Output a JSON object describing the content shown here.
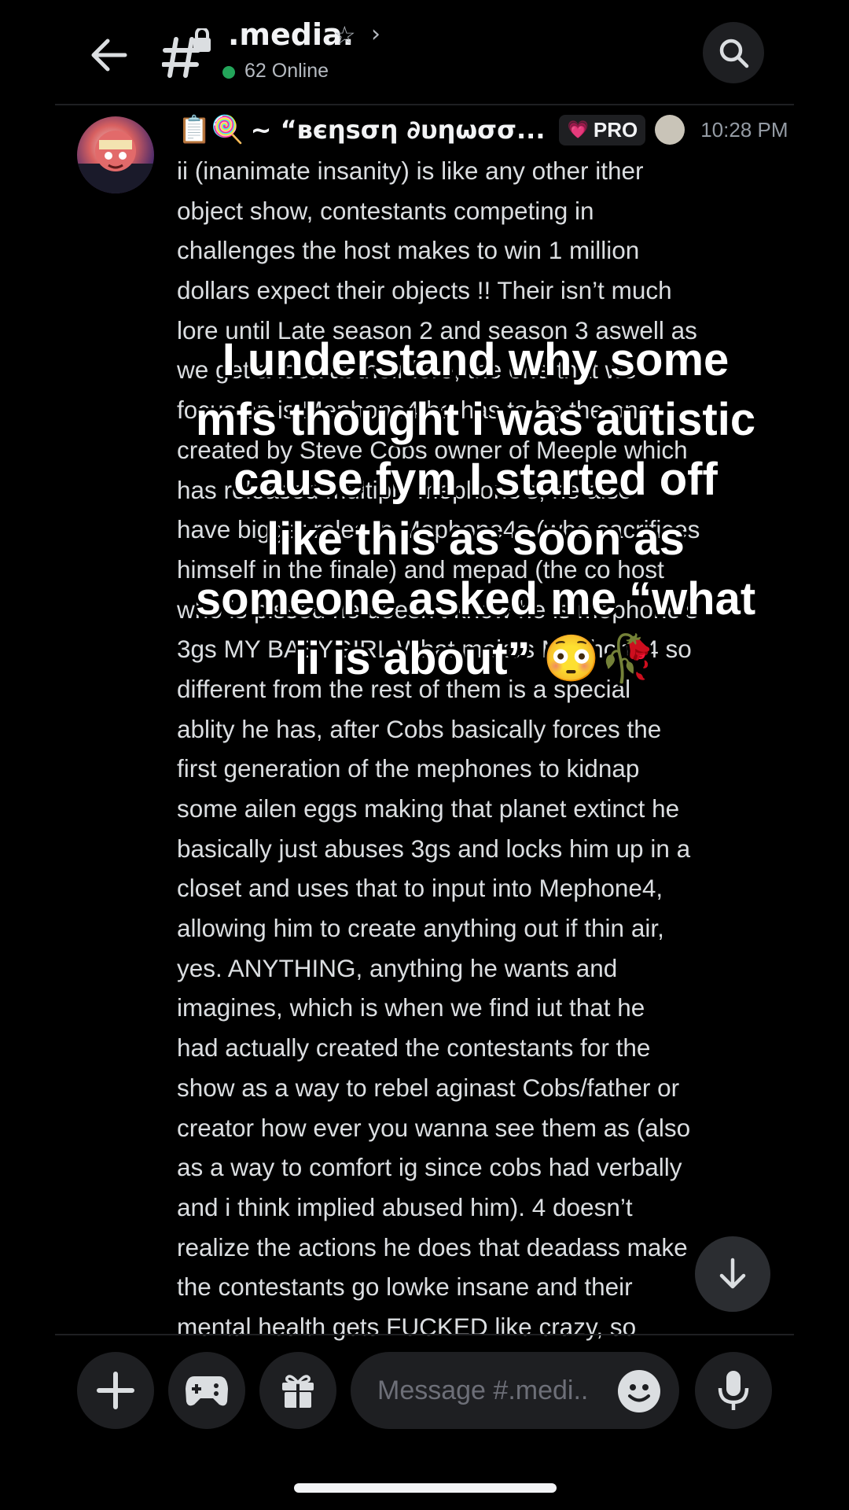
{
  "header": {
    "channel_name": ".media.",
    "online_count": "62 Online",
    "icons": [
      "back-arrow-icon",
      "text-channel-lock-icon",
      "star-icon",
      "chevron-right-icon",
      "search-icon"
    ]
  },
  "message": {
    "author_prefix_emoji": "📋🍭",
    "author": "~ “вєηѕση ∂υηωσσ...",
    "badge_text": "PRO",
    "badge_heart": "💗",
    "timestamp": "10:28 PM",
    "lines": [
      "ii (inanimate insanity) is like any other ither",
      "object show, contestants competing in",
      "challenges the host makes to win 1 million",
      "dollars expect their objects !! Their isn’t much",
      "lore until Late season 2 and season 3 aswell as",
      "we get a look at their lore, the one that we",
      "focus on is Mephone4 he has to be the one",
      "created by Steve Cobs owner of Meeple which",
      "has released multiple mephone’s, he also",
      "have bigger roles in Mephone4s (who sacrifices",
      "himself in the finale) and mepad (the co host",
      "who is pissed he doesn’t know he is mephone’s",
      "3gs MY BABYGIRL What makes Mephone4 so",
      "different from the rest of them is a special",
      "ablity he has, after Cobs basically forces the",
      "first generation of the mephones to kidnap",
      "some ailen eggs making that planet extinct he",
      "basically just abuses 3gs and locks him up in a",
      "closet and uses that to input into Mephone4,",
      "allowing him to create anything out if thin air,",
      "yes. ANYTHING, anything he wants and",
      "imagines, which is when we find iut that he",
      "had actually created the contestants for the",
      "show as a way to rebel aginast Cobs/father or",
      "creator how ever you wanna see them as (also",
      "as a way to comfort ig since cobs had verbally",
      "and i think implied abused him). 4 doesn’t",
      "realize the actions he does that deadass make",
      "the contestants go lowke insane and their",
      "mental health gets FUCKED like crazy, so"
    ]
  },
  "caption": {
    "lines": [
      "I understand why some",
      "mfs thought i was autistic",
      "cause fym I started off",
      "like this as soon as",
      "someone asked me “what",
      "ii is about” 😳🥀"
    ]
  },
  "composer": {
    "placeholder": "Message #.medi..",
    "buttons": [
      "plus-icon",
      "gamepad-icon",
      "gift-icon",
      "emoji-icon",
      "microphone-icon"
    ]
  },
  "colors": {
    "background": "#000000",
    "surface": "#1e1f22",
    "online": "#23a55a",
    "text": "#dbdee1",
    "muted": "#949ba4"
  }
}
